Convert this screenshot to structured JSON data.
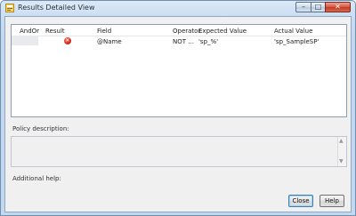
{
  "window": {
    "title": "Results Detailed View",
    "caption": {
      "minimize": "–",
      "maximize": "□",
      "close": "✕"
    }
  },
  "grid": {
    "columns": [
      "AndOr",
      "Result",
      "Field",
      "Operator",
      "Expected Value",
      "Actual Value"
    ],
    "rows": [
      {
        "andor": "",
        "result_icon": "error-icon",
        "field": "@Name",
        "operator": "NOT ...",
        "expected_value": "'sp_%'",
        "actual_value": "'sp_SampleSP'"
      }
    ]
  },
  "policy_description": {
    "label": "Policy description:",
    "text": ""
  },
  "additional_help": {
    "label": "Additional help:"
  },
  "buttons": {
    "close": "Close",
    "help": "Help"
  },
  "colors": {
    "title_bar": "#c9dcf1",
    "close_caption": "#c13a22",
    "error_icon": "#d1271a"
  }
}
